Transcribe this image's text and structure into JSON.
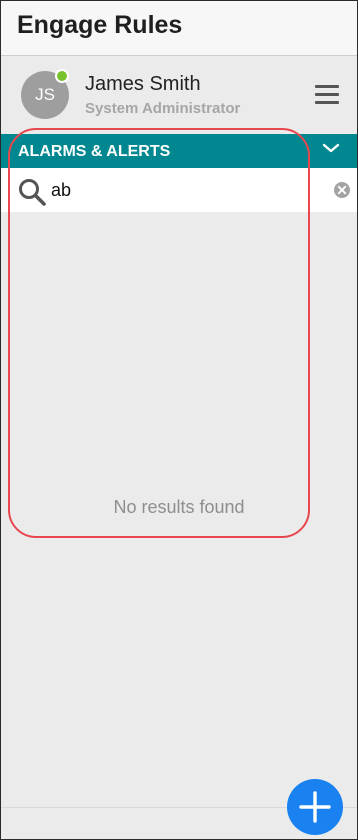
{
  "header": {
    "title": "Engage Rules"
  },
  "user": {
    "initials": "JS",
    "name": "James Smith",
    "role": "System Administrator",
    "status_color": "#78c32b"
  },
  "icons": {
    "menu": "hamburger-menu-icon",
    "chevron": "chevron-down-icon",
    "search": "search-icon",
    "clear": "clear-circle-x-icon",
    "add": "plus-icon"
  },
  "section": {
    "title": "ALARMS & ALERTS",
    "color": "#00878f"
  },
  "search": {
    "value": "ab"
  },
  "results": {
    "empty_message": "No results found"
  },
  "fab": {
    "color": "#1a82f0"
  },
  "annotation": {
    "color": "#e8474f"
  }
}
